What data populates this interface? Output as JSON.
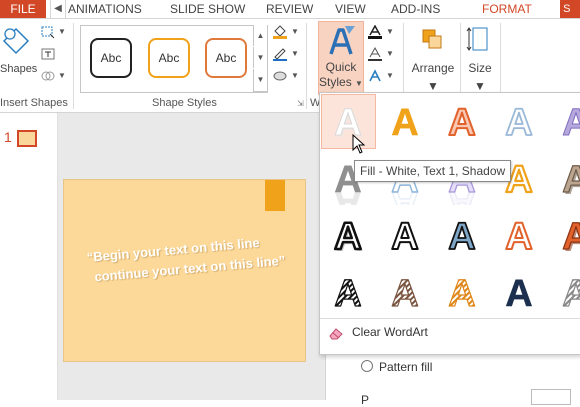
{
  "tabs": {
    "file": "FILE",
    "animations": "ANIMATIONS",
    "slide_show": "SLIDE SHOW",
    "review": "REVIEW",
    "view": "VIEW",
    "add_ins": "ADD-INS",
    "format": "FORMAT",
    "extra": "S"
  },
  "ribbon": {
    "shapes_label": "Shapes",
    "insert_shapes_group": "Insert Shapes",
    "shape_styles_group": "Shape Styles",
    "wordart_group_partial": "W",
    "style_samples": [
      "Abc",
      "Abc",
      "Abc"
    ],
    "quick_styles_line1": "Quick",
    "quick_styles_line2": "Styles",
    "arrange_label": "Arrange",
    "size_label": "Size"
  },
  "thumbnails": {
    "slide_number": "1"
  },
  "slide": {
    "line1": "“Begin your text on this line",
    "line2": "continue your text on this line”"
  },
  "format_pane": {
    "pattern_fill": "Pattern fill",
    "partial_label": "P"
  },
  "quick_styles": {
    "wordart_glyph": "A",
    "clear_wordart": "Clear WordArt",
    "tooltip": "Fill - White, Text 1, Shadow",
    "styles": [
      [
        "white-shadow",
        "orange-fill",
        "orange-outline",
        "light-blue-outline",
        "purple-gradient"
      ],
      [
        "gray-reflection",
        "blue-reflection",
        "lavender-reflection",
        "orange-bevel",
        "brown-3d"
      ],
      [
        "black-outline-shadow",
        "white-black-outline",
        "steel-blue-fill",
        "white-orange-outline",
        "orange-shadow"
      ],
      [
        "black-hatch",
        "brown-hatch",
        "orange-hatch",
        "navy-fill",
        "gray-hatch"
      ]
    ]
  },
  "colors": {
    "accent": "#d24726",
    "slide_bg": "#fdd999",
    "slide_accent": "#f0a21a",
    "selected_bg": "#fde4da"
  }
}
